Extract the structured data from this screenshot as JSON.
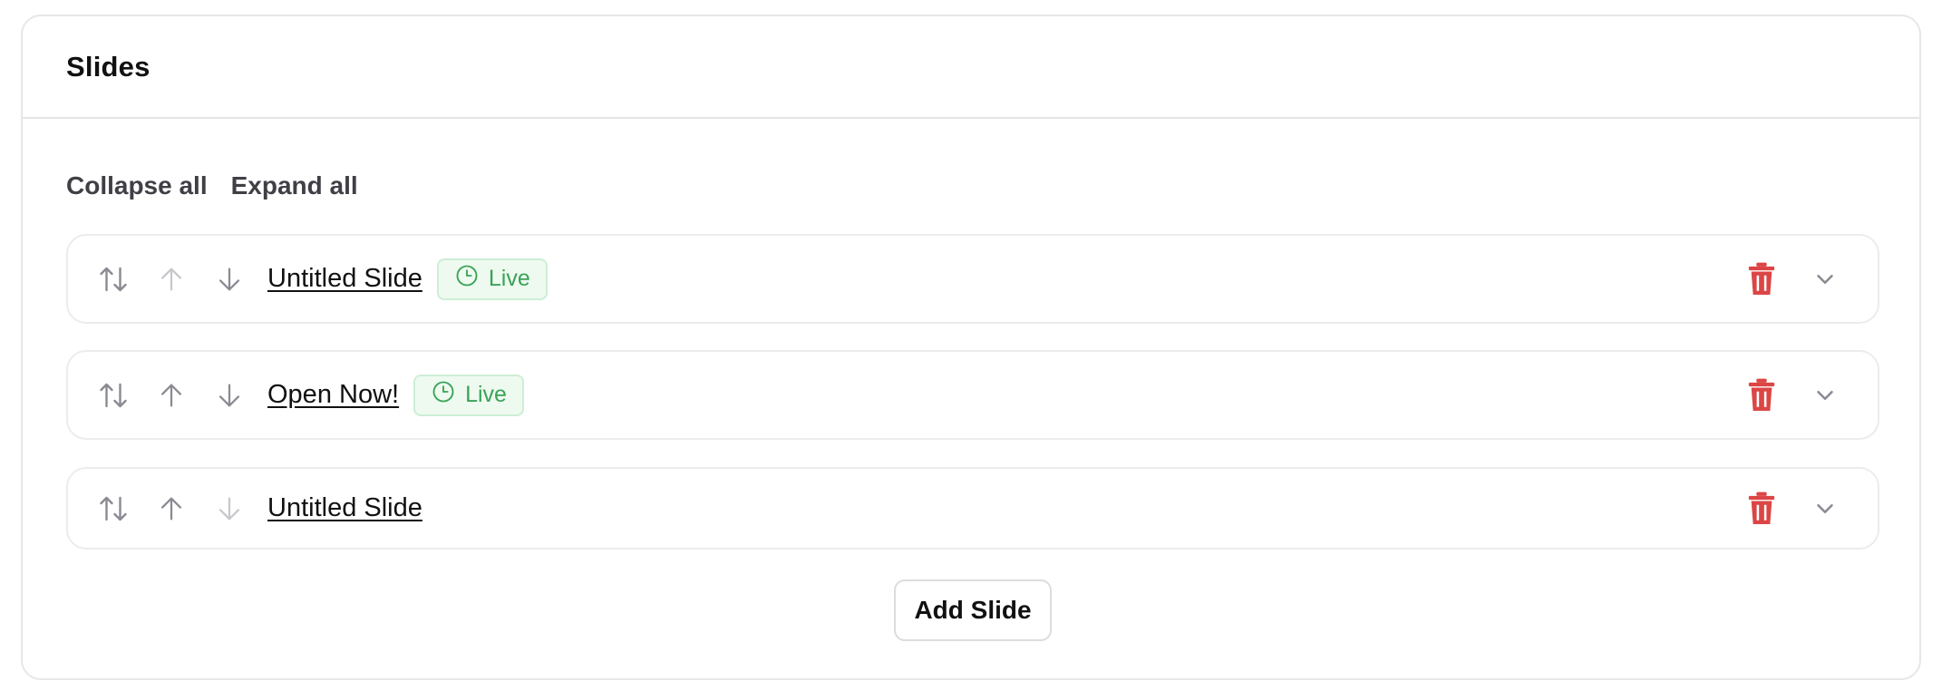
{
  "panel": {
    "title": "Slides"
  },
  "toolbar": {
    "collapse_label": "Collapse all",
    "expand_label": "Expand all"
  },
  "slides": [
    {
      "title": "Untitled Slide",
      "status": "Live",
      "up_enabled": false,
      "down_enabled": true
    },
    {
      "title": "Open Now!",
      "status": "Live",
      "up_enabled": true,
      "down_enabled": true
    },
    {
      "title": "Untitled Slide",
      "status": "",
      "up_enabled": true,
      "down_enabled": false
    }
  ],
  "actions": {
    "add_label": "Add Slide"
  },
  "colors": {
    "icon_enabled": "#8a8a93",
    "icon_disabled": "#c7c7cc",
    "delete": "#dc4545",
    "live_text": "#3aa357",
    "live_bg": "#eefaf0",
    "live_border": "#cdeed6"
  },
  "icons": {
    "sort": "sort-arrows-icon",
    "up": "arrow-up-icon",
    "down": "arrow-down-icon",
    "clock": "clock-icon",
    "delete": "trash-icon",
    "expand": "chevron-down-icon"
  }
}
